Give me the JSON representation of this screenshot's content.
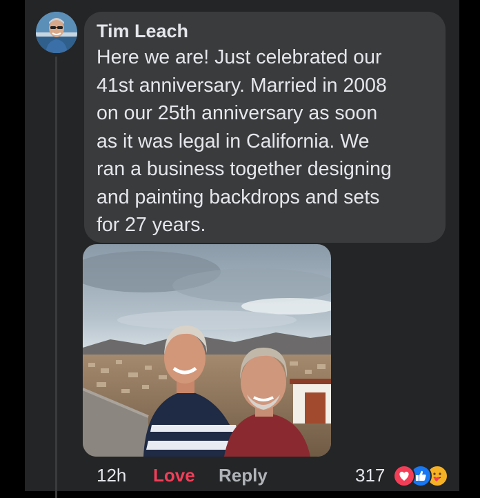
{
  "comment": {
    "author": "Tim Leach",
    "text": "Here we are! Just celebrated our\n41st anniversary. Married in 2008\non our 25th anniversary as soon\nas it was legal in California. We\nran a business together designing\nand painting backdrops and sets\nfor 27 years."
  },
  "avatar": {
    "icon": "user-avatar"
  },
  "photo": {
    "icon": "photo-attachment"
  },
  "footer": {
    "timestamp": "12h",
    "love_label": "Love",
    "reply_label": "Reply",
    "reaction_count": "317"
  },
  "reactions": [
    {
      "icon": "love-heart-icon",
      "color": "#f33e58"
    },
    {
      "icon": "like-thumb-icon",
      "color": "#1877f2"
    },
    {
      "icon": "care-hug-icon",
      "color": "#f7b125"
    }
  ],
  "colors": {
    "background": "#242526",
    "bubble": "#3a3b3c",
    "text": "#e4e6eb",
    "love": "#f33e58",
    "secondary": "#b0b3b8"
  }
}
